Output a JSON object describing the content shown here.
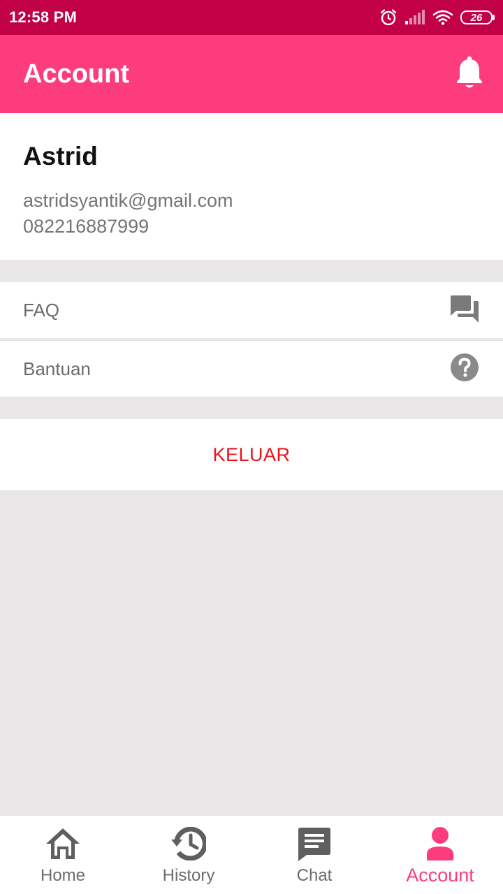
{
  "status_bar": {
    "time": "12:58 PM",
    "battery": "26",
    "icons": [
      "alarm-icon",
      "signal-icon",
      "wifi-icon",
      "battery-icon"
    ]
  },
  "app_bar": {
    "title": "Account",
    "action_icon": "bell-icon"
  },
  "profile": {
    "name": "Astrid",
    "email": "astridsyantik@gmail.com",
    "phone": "082216887999"
  },
  "menu": {
    "items": [
      {
        "label": "FAQ",
        "icon": "forum-icon"
      },
      {
        "label": "Bantuan",
        "icon": "help-circle-icon"
      }
    ],
    "logout_label": "KELUAR"
  },
  "bottom_nav": {
    "items": [
      {
        "label": "Home",
        "icon": "home-icon",
        "active": false
      },
      {
        "label": "History",
        "icon": "history-icon",
        "active": false
      },
      {
        "label": "Chat",
        "icon": "chat-icon",
        "active": false
      },
      {
        "label": "Account",
        "icon": "account-icon",
        "active": true
      }
    ]
  },
  "colors": {
    "status_bar": "#c20044",
    "primary": "#fc3c7c",
    "logout": "#e8141c",
    "background": "#e8e6e7",
    "icon_gray": "#6b6b6b"
  }
}
